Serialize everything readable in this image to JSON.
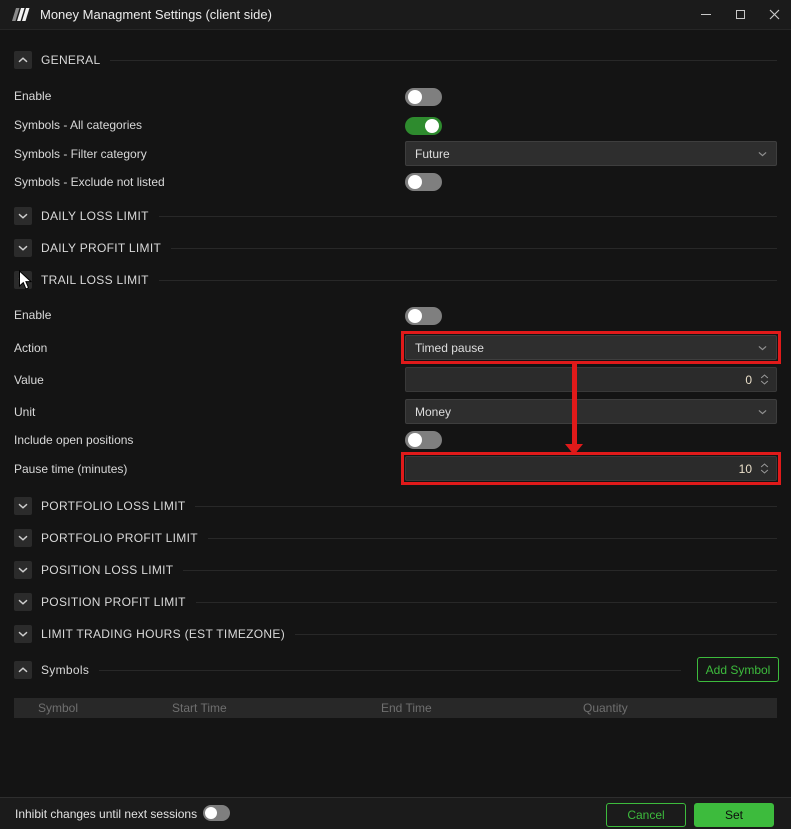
{
  "titlebar": {
    "title": "Money Managment Settings (client side)"
  },
  "sections": {
    "general": {
      "label": "GENERAL",
      "expanded": true
    },
    "daily_loss": {
      "label": "DAILY LOSS LIMIT",
      "expanded": false
    },
    "daily_profit": {
      "label": "DAILY PROFIT LIMIT",
      "expanded": false
    },
    "trail_loss": {
      "label": "TRAIL LOSS LIMIT",
      "expanded": true
    },
    "portfolio_loss": {
      "label": "PORTFOLIO LOSS LIMIT",
      "expanded": false
    },
    "portfolio_profit": {
      "label": "PORTFOLIO PROFIT LIMIT",
      "expanded": false
    },
    "position_loss": {
      "label": "POSITION LOSS LIMIT",
      "expanded": false
    },
    "position_profit": {
      "label": "POSITION PROFIT LIMIT",
      "expanded": false
    },
    "trading_hours": {
      "label": "LIMIT TRADING HOURS (EST TIMEZONE)",
      "expanded": false
    },
    "symbols": {
      "label": "Symbols",
      "expanded": true
    }
  },
  "general_rows": {
    "enable": {
      "label": "Enable",
      "state": "off"
    },
    "all_categories": {
      "label": "Symbols - All categories",
      "state": "on"
    },
    "filter_category": {
      "label": "Symbols - Filter category",
      "value": "Future"
    },
    "exclude_not_listed": {
      "label": "Symbols - Exclude not listed",
      "state": "off"
    }
  },
  "trail_rows": {
    "enable": {
      "label": "Enable",
      "state": "off"
    },
    "action": {
      "label": "Action",
      "value": "Timed pause"
    },
    "value": {
      "label": "Value",
      "value": "0"
    },
    "unit": {
      "label": "Unit",
      "value": "Money"
    },
    "include_open_positions": {
      "label": "Include open positions",
      "state": "off"
    },
    "pause_time": {
      "label": "Pause time (minutes)",
      "value": "10"
    }
  },
  "symbols_panel": {
    "add_button_label": "Add Symbol",
    "columns": [
      "Symbol",
      "Start Time",
      "End Time",
      "Quantity"
    ],
    "rows": []
  },
  "footer": {
    "inhibit_label": "Inhibit changes until next sessions",
    "inhibit_state": "off",
    "cancel_label": "Cancel",
    "set_label": "Set"
  },
  "annotations": {
    "highlight_color": "#e01a1a",
    "highlighted_fields": [
      "Action",
      "Pause time (minutes)"
    ]
  },
  "colors": {
    "accent_green": "#3dbb3d",
    "toggle_on_green": "#2e8b2e",
    "annotation_red": "#e01a1a",
    "window_bg": "#141414",
    "titlebar_bg": "#1b1b1b"
  }
}
